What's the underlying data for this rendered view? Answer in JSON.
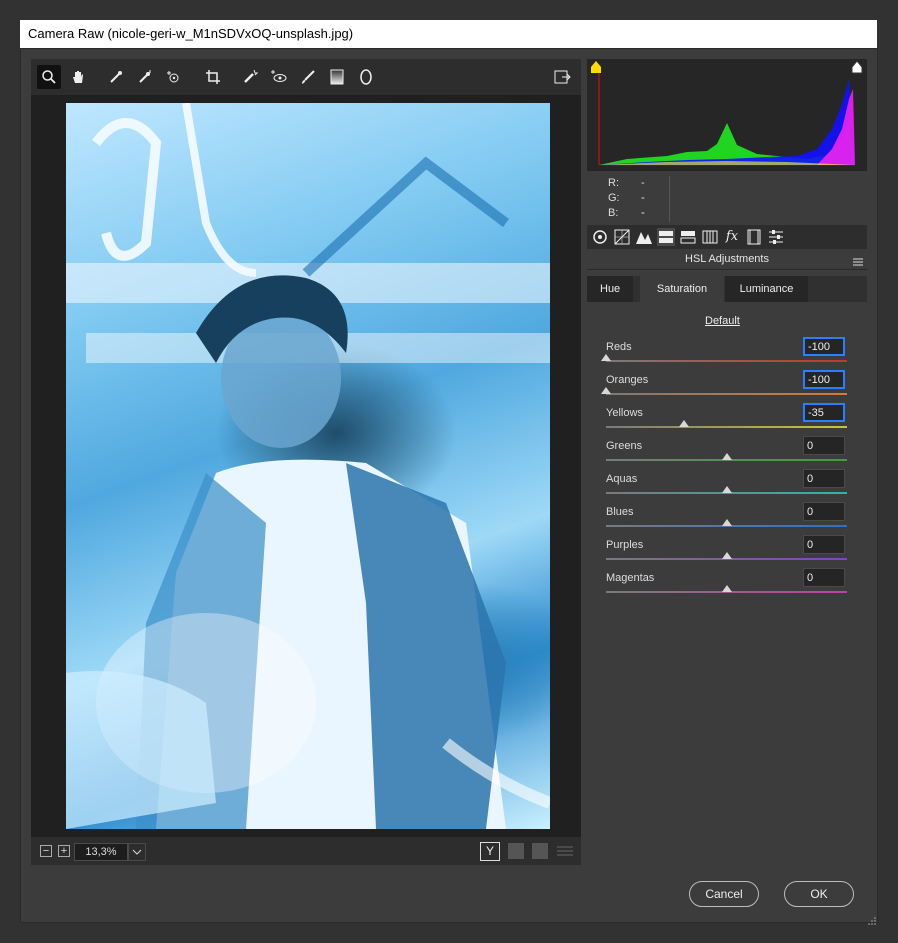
{
  "window": {
    "title": "Camera Raw (nicole-geri-w_M1nSDVxOQ-unsplash.jpg)"
  },
  "histogram": {
    "r_label": "R:",
    "g_label": "G:",
    "b_label": "B:",
    "r_value": "---",
    "g_value": "---",
    "b_value": "---"
  },
  "panel": {
    "title": "HSL Adjustments",
    "default_link": "Default"
  },
  "tabs": [
    {
      "label": "Hue"
    },
    {
      "label": "Saturation"
    },
    {
      "label": "Luminance"
    }
  ],
  "rows": [
    {
      "label": "Reds",
      "value": "-100",
      "level": -100,
      "color": "#c0392b"
    },
    {
      "label": "Oranges",
      "value": "-100",
      "level": -100,
      "color": "#d97a2b"
    },
    {
      "label": "Yellows",
      "value": "-35",
      "level": -35,
      "color": "#c9c43a"
    },
    {
      "label": "Greens",
      "value": "0",
      "level": 0,
      "color": "#3aa03a"
    },
    {
      "label": "Aquas",
      "value": "0",
      "level": 0,
      "color": "#2ab7a9"
    },
    {
      "label": "Blues",
      "value": "0",
      "level": 0,
      "color": "#2f6fd1"
    },
    {
      "label": "Purples",
      "value": "0",
      "level": 0,
      "color": "#8a3fc2"
    },
    {
      "label": "Magentas",
      "value": "0",
      "level": 0,
      "color": "#c23fa6"
    }
  ],
  "zoom": {
    "value": "13,3%"
  },
  "buttons": {
    "cancel": "Cancel",
    "ok": "OK"
  },
  "colors": {
    "focus": "#2a7fff"
  },
  "icons": [
    "zoom-icon",
    "hand-icon",
    "white-balance-icon",
    "color-sampler-icon",
    "targeted-adjustment-icon",
    "crop-icon",
    "spot-removal-icon",
    "red-eye-icon",
    "adjustment-brush-icon",
    "graduated-filter-icon",
    "radial-filter-icon",
    "open-preferences-icon"
  ]
}
